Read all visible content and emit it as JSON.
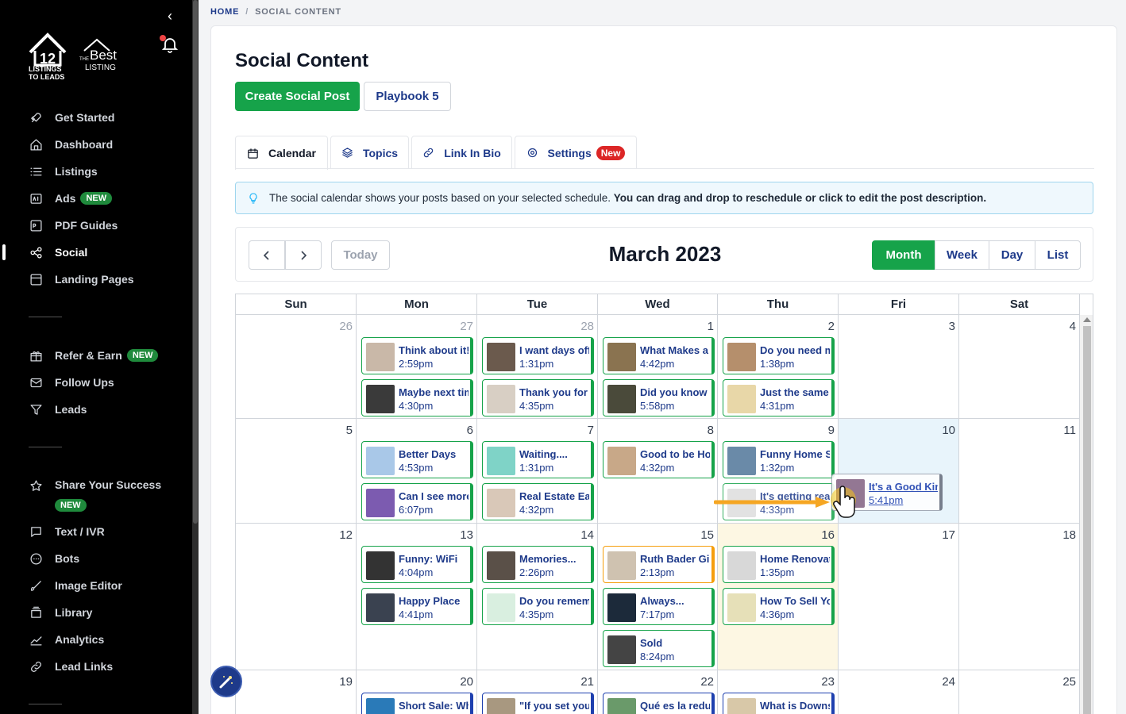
{
  "sidebar": {
    "logo_primary_lines": [
      "LISTINGS",
      "TO LEADS"
    ],
    "logo_secondary_lines": [
      "THE",
      "Best",
      "LISTING"
    ],
    "new_badge": "NEW",
    "items": [
      {
        "label": "Get Started",
        "icon": "rocket-icon"
      },
      {
        "label": "Dashboard",
        "icon": "home-icon"
      },
      {
        "label": "Listings",
        "icon": "list-icon"
      },
      {
        "label": "Ads",
        "icon": "ad-icon",
        "badge": "NEW"
      },
      {
        "label": "PDF Guides",
        "icon": "pdf-icon"
      },
      {
        "label": "Social",
        "icon": "share-icon",
        "active": true
      },
      {
        "label": "Landing Pages",
        "icon": "page-icon"
      },
      {
        "label": "Refer & Earn",
        "icon": "gift-icon",
        "badge": "NEW"
      },
      {
        "label": "Follow Ups",
        "icon": "mail-icon"
      },
      {
        "label": "Leads",
        "icon": "filter-icon"
      },
      {
        "label": "Share Your Success",
        "icon": "star-icon",
        "badge": "NEW"
      },
      {
        "label": "Text / IVR",
        "icon": "chat-icon"
      },
      {
        "label": "Bots",
        "icon": "bot-icon"
      },
      {
        "label": "Image Editor",
        "icon": "brush-icon"
      },
      {
        "label": "Library",
        "icon": "library-icon"
      },
      {
        "label": "Analytics",
        "icon": "chart-icon"
      },
      {
        "label": "Lead Links",
        "icon": "link-icon"
      }
    ]
  },
  "breadcrumb": {
    "home": "HOME",
    "current": "SOCIAL CONTENT"
  },
  "page": {
    "title": "Social Content",
    "create_label": "Create Social Post",
    "playbook_label": "Playbook 5"
  },
  "tabs": [
    {
      "label": "Calendar",
      "icon": "calendar-icon"
    },
    {
      "label": "Topics",
      "icon": "layers-icon"
    },
    {
      "label": "Link In Bio",
      "icon": "link-icon"
    },
    {
      "label": "Settings",
      "icon": "gear-icon",
      "badge": "New"
    }
  ],
  "info": {
    "text": "The social calendar shows your posts based on your selected schedule.",
    "bold": "You can drag and drop to reschedule or click to edit the post description."
  },
  "calendar": {
    "title": "March 2023",
    "today_label": "Today",
    "prev_icon": "chevron-left-icon",
    "next_icon": "chevron-right-icon",
    "views": [
      "Month",
      "Week",
      "Day",
      "List"
    ],
    "active_view": "Month",
    "weekdays": [
      "Sun",
      "Mon",
      "Tue",
      "Wed",
      "Thu",
      "Fri",
      "Sat"
    ],
    "weeks": [
      [
        "26",
        "27",
        "28",
        "1",
        "2",
        "3",
        "4"
      ],
      [
        "5",
        "6",
        "7",
        "8",
        "9",
        "10",
        "11"
      ],
      [
        "12",
        "13",
        "14",
        "15",
        "16",
        "17",
        "18"
      ],
      [
        "19",
        "20",
        "21",
        "22",
        "23",
        "24",
        "25"
      ]
    ],
    "events": [
      {
        "week": 0,
        "day": 1,
        "slot": 0,
        "title": "Think about it!",
        "time": "2:59pm",
        "color": "green",
        "thumb": "#c9b8a8"
      },
      {
        "week": 0,
        "day": 1,
        "slot": 1,
        "title": "Maybe next time",
        "time": "4:30pm",
        "color": "green",
        "thumb": "#3a3a3a"
      },
      {
        "week": 0,
        "day": 2,
        "slot": 0,
        "title": "I want days off",
        "time": "1:31pm",
        "color": "green",
        "thumb": "#6b5a4d"
      },
      {
        "week": 0,
        "day": 2,
        "slot": 1,
        "title": "Thank you for",
        "time": "4:35pm",
        "color": "green",
        "thumb": "#d8cfc4"
      },
      {
        "week": 0,
        "day": 3,
        "slot": 0,
        "title": "What Makes a",
        "time": "4:42pm",
        "color": "green",
        "thumb": "#8a7350"
      },
      {
        "week": 0,
        "day": 3,
        "slot": 1,
        "title": "Did you know",
        "time": "5:58pm",
        "color": "green",
        "thumb": "#4a4a3a"
      },
      {
        "week": 0,
        "day": 4,
        "slot": 0,
        "title": "Do you need m",
        "time": "1:38pm",
        "color": "green",
        "thumb": "#b58f6c"
      },
      {
        "week": 0,
        "day": 4,
        "slot": 1,
        "title": "Just the same",
        "time": "4:31pm",
        "color": "green",
        "thumb": "#e8d7a8"
      },
      {
        "week": 1,
        "day": 1,
        "slot": 0,
        "title": "Better Days",
        "time": "4:53pm",
        "color": "green",
        "thumb": "#a9c8e8"
      },
      {
        "week": 1,
        "day": 1,
        "slot": 1,
        "title": "Can I see more",
        "time": "6:07pm",
        "color": "green",
        "thumb": "#7c5bb0"
      },
      {
        "week": 1,
        "day": 2,
        "slot": 0,
        "title": "Waiting....",
        "time": "1:31pm",
        "color": "green",
        "thumb": "#7fd3c7"
      },
      {
        "week": 1,
        "day": 2,
        "slot": 1,
        "title": "Real Estate Eag",
        "time": "4:32pm",
        "color": "green",
        "thumb": "#d9c8b8"
      },
      {
        "week": 1,
        "day": 3,
        "slot": 0,
        "title": "Good to be Ho",
        "time": "4:32pm",
        "color": "green",
        "thumb": "#c8a888"
      },
      {
        "week": 1,
        "day": 4,
        "slot": 0,
        "title": "Funny Home S",
        "time": "1:32pm",
        "color": "green",
        "thumb": "#6a8aa8"
      },
      {
        "week": 1,
        "day": 4,
        "slot": 1,
        "title": "It's getting rea",
        "time": "4:33pm",
        "color": "green",
        "thumb": "#ddd",
        "ghost": true
      },
      {
        "week": 2,
        "day": 1,
        "slot": 0,
        "title": "Funny: WiFi",
        "time": "4:04pm",
        "color": "green",
        "thumb": "#333"
      },
      {
        "week": 2,
        "day": 1,
        "slot": 1,
        "title": "Happy Place",
        "time": "4:41pm",
        "color": "green",
        "thumb": "#3a4250"
      },
      {
        "week": 2,
        "day": 2,
        "slot": 0,
        "title": "Memories...",
        "time": "2:26pm",
        "color": "green",
        "thumb": "#5a5048"
      },
      {
        "week": 2,
        "day": 2,
        "slot": 1,
        "title": "Do you remem",
        "time": "4:35pm",
        "color": "green",
        "thumb": "#d9efe0"
      },
      {
        "week": 2,
        "day": 3,
        "slot": 0,
        "title": "Ruth Bader Gin",
        "time": "2:13pm",
        "color": "orange",
        "thumb": "#cfc2b0"
      },
      {
        "week": 2,
        "day": 3,
        "slot": 1,
        "title": "Always...",
        "time": "7:17pm",
        "color": "green",
        "thumb": "#1c2a3a"
      },
      {
        "week": 2,
        "day": 3,
        "slot": 2,
        "title": "Sold",
        "time": "8:24pm",
        "color": "green",
        "thumb": "#444"
      },
      {
        "week": 2,
        "day": 4,
        "slot": 0,
        "title": "Home Renovat",
        "time": "1:35pm",
        "color": "green",
        "thumb": "#d8d8d8"
      },
      {
        "week": 2,
        "day": 4,
        "slot": 1,
        "title": "How To Sell Yo",
        "time": "4:36pm",
        "color": "green",
        "thumb": "#e6e0b8"
      },
      {
        "week": 3,
        "day": 1,
        "slot": 0,
        "title": "Short Sale: Wh",
        "time": "",
        "color": "blue",
        "thumb": "#2a7ab8"
      },
      {
        "week": 3,
        "day": 2,
        "slot": 0,
        "title": "\"If you set you",
        "time": "",
        "color": "blue",
        "thumb": "#a89880"
      },
      {
        "week": 3,
        "day": 3,
        "slot": 0,
        "title": "Qué es la redu",
        "time": "",
        "color": "blue",
        "thumb": "#6a9a6a"
      },
      {
        "week": 3,
        "day": 4,
        "slot": 0,
        "title": "What is Downs",
        "time": "",
        "color": "blue",
        "thumb": "#d8c8a8"
      }
    ],
    "dragging": {
      "title": "It's a Good Kin",
      "time": "5:41pm",
      "thumb": "#8a6a88"
    }
  },
  "colors": {
    "accent": "#16a34a",
    "brand": "#1e3a8a",
    "today": "#fdf7e3",
    "drop": "#e8f4fb",
    "danger": "#dc2626",
    "arrow": "#f5a623"
  }
}
